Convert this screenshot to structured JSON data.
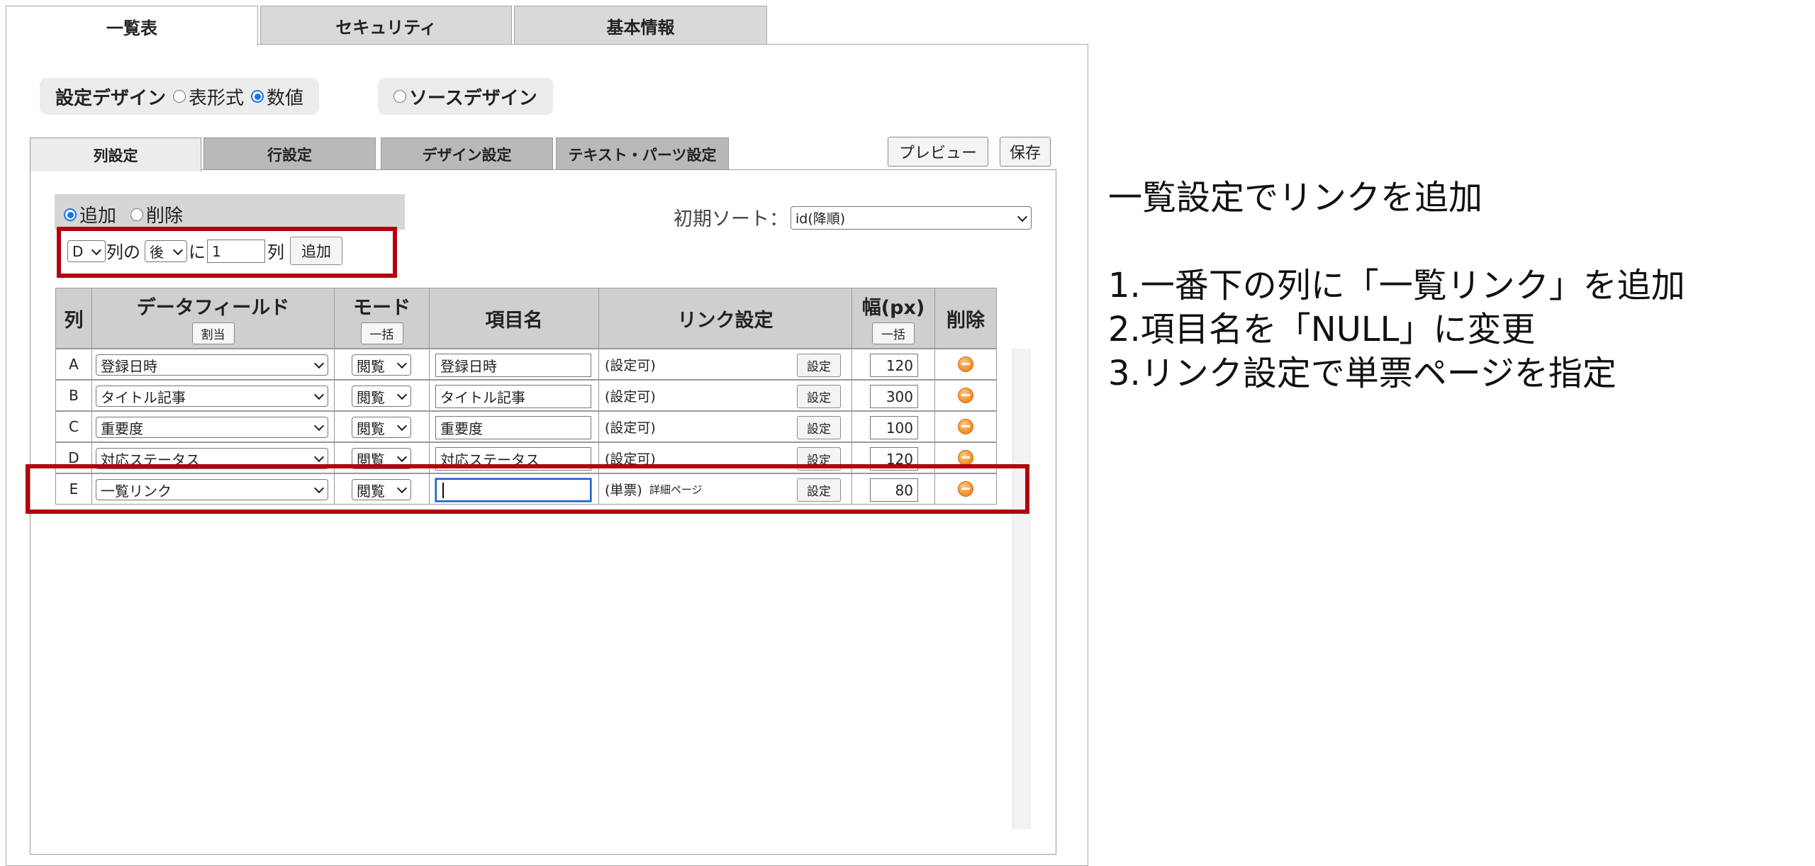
{
  "top_tabs": [
    "一覧表",
    "セキュリティ",
    "基本情報"
  ],
  "design": {
    "label": "設定デザイン",
    "option_table": "表形式",
    "option_number": "数値",
    "source_design": "ソースデザイン"
  },
  "sub_tabs": [
    "列設定",
    "行設定",
    "デザイン設定",
    "テキスト・パーツ設定"
  ],
  "buttons": {
    "preview": "プレビュー",
    "save": "保存"
  },
  "add_delete": {
    "add_label": "追加",
    "delete_label": "削除",
    "column_select": "D",
    "text_col_of": "列の",
    "position_select": "後",
    "text_ni": "に",
    "count_value": "1",
    "text_col": "列",
    "add_button": "追加"
  },
  "initial_sort": {
    "label": "初期ソート：",
    "value": "id(降順)"
  },
  "grid": {
    "headers": {
      "col": "列",
      "data_field": "データフィールド",
      "assign_button": "割当",
      "mode": "モード",
      "bulk_button": "一括",
      "item_name": "項目名",
      "link_setting": "リンク設定",
      "width": "幅(px)",
      "width_bulk": "一括",
      "delete": "削除"
    },
    "setting_button": "設定",
    "rows": [
      {
        "col": "A",
        "field": "登録日時",
        "mode": "閲覧",
        "name": "登録日時",
        "link": "(設定可)",
        "link_detail": "",
        "width": "120"
      },
      {
        "col": "B",
        "field": "タイトル記事",
        "mode": "閲覧",
        "name": "タイトル記事",
        "link": "(設定可)",
        "link_detail": "",
        "width": "300"
      },
      {
        "col": "C",
        "field": "重要度",
        "mode": "閲覧",
        "name": "重要度",
        "link": "(設定可)",
        "link_detail": "",
        "width": "100"
      },
      {
        "col": "D",
        "field": "対応ステータス",
        "mode": "閲覧",
        "name": "対応ステータス",
        "link": "(設定可)",
        "link_detail": "",
        "width": "120"
      },
      {
        "col": "E",
        "field": "一覧リンク",
        "mode": "閲覧",
        "name": "",
        "link": "(単票)",
        "link_detail": "詳細ページ",
        "width": "80"
      }
    ]
  },
  "notes": {
    "title": "一覧設定でリンクを追加",
    "steps": [
      "1.一番下の列に「一覧リンク」を追加",
      "2.項目名を「NULL」に変更",
      "3.リンク設定で単票ページを指定"
    ]
  },
  "colors": {
    "highlight_red": "#b3000d",
    "radio_blue": "#1a73e8",
    "delete_orange": "#f08a24"
  }
}
